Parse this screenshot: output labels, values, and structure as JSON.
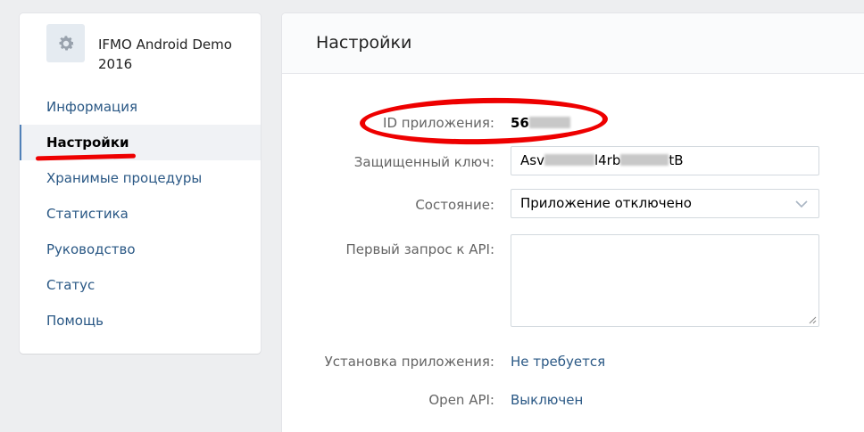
{
  "app": {
    "title": "IFMO Android Demo 2016",
    "icon": "gear-icon"
  },
  "sidebar": {
    "items": [
      {
        "label": "Информация",
        "active": false
      },
      {
        "label": "Настройки",
        "active": true
      },
      {
        "label": "Хранимые процедуры",
        "active": false
      },
      {
        "label": "Статистика",
        "active": false
      },
      {
        "label": "Руководство",
        "active": false
      },
      {
        "label": "Статус",
        "active": false
      },
      {
        "label": "Помощь",
        "active": false
      }
    ]
  },
  "main": {
    "title": "Настройки",
    "app_id": {
      "label": "ID приложения:",
      "value_visible": "56"
    },
    "secure_key": {
      "label": "Защищенный ключ:",
      "part1": "Asv",
      "part2": "l4rb",
      "part3": "tB"
    },
    "state": {
      "label": "Состояние:",
      "value": "Приложение отключено"
    },
    "first_api_request": {
      "label": "Первый запрос к API:",
      "value": ""
    },
    "install": {
      "label": "Установка приложения:",
      "value": "Не требуется"
    },
    "open_api": {
      "label": "Open API:",
      "value": "Выключен"
    }
  },
  "colors": {
    "link": "#2a5885",
    "annotation_red": "#e00000",
    "accent": "#5181b8"
  }
}
